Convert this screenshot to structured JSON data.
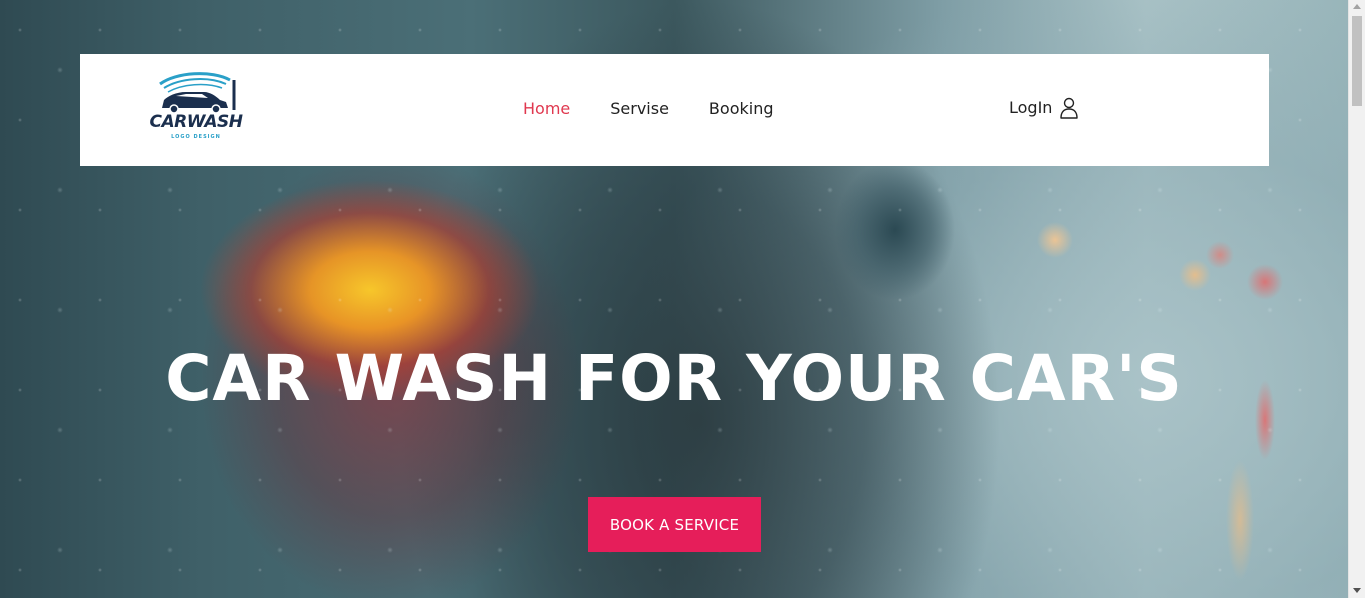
{
  "nav": {
    "logo": {
      "text": "CARWASH",
      "subtext": "LOGO DESIGN",
      "colors": {
        "primary": "#1b2f4e",
        "accent": "#2aa0c8"
      }
    },
    "links": [
      {
        "label": "Home",
        "active": true
      },
      {
        "label": "Servise",
        "active": false
      },
      {
        "label": "Booking",
        "active": false
      }
    ],
    "login_label": "LogIn",
    "login_icon": "user-icon"
  },
  "hero": {
    "title": "CAR WASH FOR YOUR CAR'S",
    "cta_label": "BOOK A SERVICE"
  },
  "colors": {
    "accent": "#e61e5a",
    "active_link": "#e0384f",
    "navbar_bg": "#ffffff",
    "title": "#ffffff"
  }
}
